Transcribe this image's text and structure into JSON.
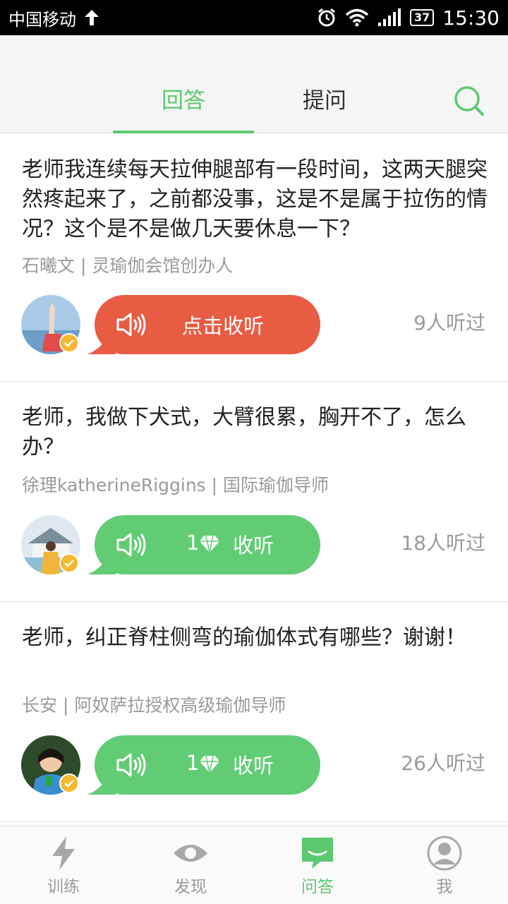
{
  "status_bar": {
    "carrier": "中国移动",
    "battery": "37",
    "time": "15:30"
  },
  "tabs": [
    {
      "label": "回答",
      "active": true
    },
    {
      "label": "提问",
      "active": false
    }
  ],
  "accent_color": "#5cc96f",
  "listen_color": "#e85c44",
  "items": [
    {
      "question": "老师我连续每天拉伸腿部有一段时间，这两天腿突然疼起来了，之前都没事，这是不是属于拉伤的情况？这个是不是做几天要休息一下？",
      "author": "石曦文 | 灵瑜伽会馆创办人",
      "button_label": "点击收听",
      "listeners": "9人听过"
    },
    {
      "question": "老师，我做下犬式，大臂很累，胸开不了，怎么办？",
      "author": "徐理katherineRiggins | 国际瑜伽导师",
      "price": "1",
      "button_label": "收听",
      "listeners": "18人听过"
    },
    {
      "question": "老师，纠正脊柱侧弯的瑜伽体式有哪些？谢谢！",
      "author": "长安 | 阿奴萨拉授权高级瑜伽导师",
      "price": "1",
      "button_label": "收听",
      "listeners": "26人听过"
    }
  ],
  "bottom_nav": [
    {
      "label": "训练",
      "icon": "lightning-icon"
    },
    {
      "label": "发现",
      "icon": "eye-icon"
    },
    {
      "label": "问答",
      "icon": "chat-icon",
      "active": true
    },
    {
      "label": "我",
      "icon": "person-icon"
    }
  ]
}
